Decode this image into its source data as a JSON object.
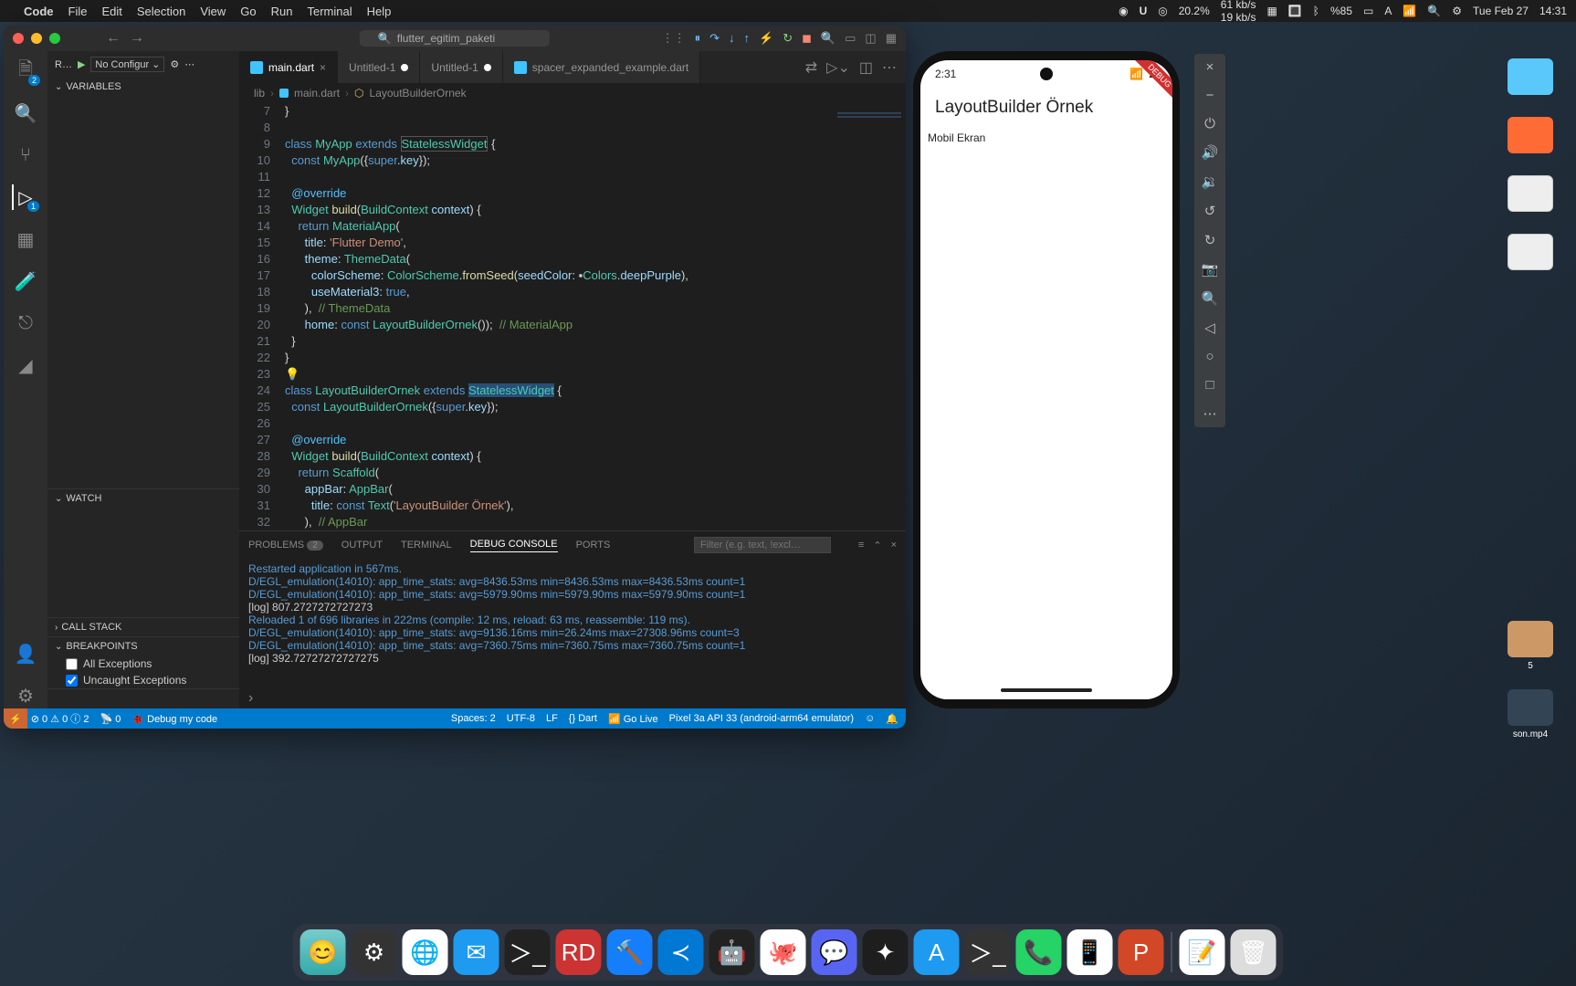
{
  "menubar": {
    "app": "Code",
    "items": [
      "File",
      "Edit",
      "Selection",
      "View",
      "Go",
      "Run",
      "Terminal",
      "Help"
    ],
    "right": {
      "cpu": "20.2%",
      "net_up": "61 kb/s",
      "net_down": "19 kb/s",
      "battery": "%85",
      "date": "Tue Feb 27",
      "time": "14:31"
    }
  },
  "vscode": {
    "title_search": "flutter_egitim_paketi",
    "tabs": [
      {
        "label": "main.dart",
        "active": true,
        "dirty": false
      },
      {
        "label": "Untitled-1",
        "active": false,
        "dirty": true
      },
      {
        "label": "Untitled-1",
        "active": false,
        "dirty": true
      },
      {
        "label": "spacer_expanded_example.dart",
        "active": false,
        "dirty": false
      }
    ],
    "breadcrumb": [
      "lib",
      "main.dart",
      "LayoutBuilderOrnek"
    ],
    "run_config_prefix": "R…",
    "run_config": "No Configur",
    "sidebar": {
      "variables": "VARIABLES",
      "watch": "WATCH",
      "call_stack": "CALL STACK",
      "breakpoints": "BREAKPOINTS",
      "bp_all": "All Exceptions",
      "bp_uncaught": "Uncaught Exceptions"
    },
    "code_lines": [
      {
        "n": 7,
        "html": "<span class='punc'>}</span>"
      },
      {
        "n": 8,
        "html": ""
      },
      {
        "n": 9,
        "html": "<span class='kw'>class</span> <span class='cls'>MyApp</span> <span class='kw'>extends</span> <span class='cls hlbox'>StatelessWidget</span> <span class='punc'>{</span>"
      },
      {
        "n": 10,
        "html": "  <span class='kw'>const</span> <span class='cls'>MyApp</span><span class='punc'>({</span><span class='kw'>super</span>.<span class='var'>key</span><span class='punc'>});</span>"
      },
      {
        "n": 11,
        "html": ""
      },
      {
        "n": 12,
        "html": "  <span class='at'>@override</span>"
      },
      {
        "n": 13,
        "html": "  <span class='cls'>Widget</span> <span class='fn'>build</span><span class='punc'>(</span><span class='cls'>BuildContext</span> <span class='var'>context</span><span class='punc'>) {</span>"
      },
      {
        "n": 14,
        "html": "    <span class='kw'>return</span> <span class='cls'>MaterialApp</span><span class='punc'>(</span>"
      },
      {
        "n": 15,
        "html": "      <span class='var'>title</span>: <span class='str'>'Flutter Demo'</span>,"
      },
      {
        "n": 16,
        "html": "      <span class='var'>theme</span>: <span class='cls'>ThemeData</span><span class='punc'>(</span>"
      },
      {
        "n": 17,
        "html": "        <span class='var'>colorScheme</span>: <span class='cls'>ColorScheme</span>.<span class='fn'>fromSeed</span><span class='punc'>(</span><span class='var'>seedColor</span>: ▪<span class='cls'>Colors</span>.<span class='var'>deepPurple</span><span class='punc'>),</span>"
      },
      {
        "n": 18,
        "html": "        <span class='var'>useMaterial3</span>: <span class='const'>true</span>,"
      },
      {
        "n": 19,
        "html": "      <span class='punc'>),</span>  <span class='cmt'>// ThemeData</span>"
      },
      {
        "n": 20,
        "html": "      <span class='var'>home</span>: <span class='kw'>const</span> <span class='cls'>LayoutBuilderOrnek</span><span class='punc'>());</span>  <span class='cmt'>// MaterialApp</span>"
      },
      {
        "n": 21,
        "html": "  <span class='punc'>}</span>"
      },
      {
        "n": 22,
        "html": "<span class='punc'>}</span>"
      },
      {
        "n": 23,
        "html": "<span style='color:#ffcc00'>💡</span>"
      },
      {
        "n": 24,
        "html": "<span class='kw'>class</span> <span class='cls'>LayoutBuilderOrnek</span> <span class='kw'>extends</span> <span class='cls hl'>StatelessWidget</span> <span class='punc'>{</span>"
      },
      {
        "n": 25,
        "html": "  <span class='kw'>const</span> <span class='cls'>LayoutBuilderOrnek</span><span class='punc'>({</span><span class='kw'>super</span>.<span class='var'>key</span><span class='punc'>});</span>"
      },
      {
        "n": 26,
        "html": ""
      },
      {
        "n": 27,
        "html": "  <span class='at'>@override</span>"
      },
      {
        "n": 28,
        "html": "  <span class='cls'>Widget</span> <span class='fn'>build</span><span class='punc'>(</span><span class='cls'>BuildContext</span> <span class='var'>context</span><span class='punc'>) {</span>"
      },
      {
        "n": 29,
        "html": "    <span class='kw'>return</span> <span class='cls'>Scaffold</span><span class='punc'>(</span>"
      },
      {
        "n": 30,
        "html": "      <span class='var'>appBar</span>: <span class='cls'>AppBar</span><span class='punc'>(</span>"
      },
      {
        "n": 31,
        "html": "        <span class='var'>title</span>: <span class='kw'>const</span> <span class='cls'>Text</span><span class='punc'>(</span><span class='str'>'LayoutBuilder Örnek'</span><span class='punc'>),</span>"
      },
      {
        "n": 32,
        "html": "      <span class='punc'>),</span>  <span class='cmt'>// AppBar</span>"
      }
    ],
    "panel": {
      "tabs": {
        "problems": "PROBLEMS",
        "problems_count": "2",
        "output": "OUTPUT",
        "terminal": "TERMINAL",
        "debug": "DEBUG CONSOLE",
        "ports": "PORTS"
      },
      "filter_placeholder": "Filter (e.g. text, !excl…",
      "lines": [
        "Restarted application in 567ms.",
        "D/EGL_emulation(14010): app_time_stats: avg=8436.53ms min=8436.53ms max=8436.53ms count=1",
        "D/EGL_emulation(14010): app_time_stats: avg=5979.90ms min=5979.90ms max=5979.90ms count=1",
        "[log] 807.2727272727273",
        "Reloaded 1 of 696 libraries in 222ms (compile: 12 ms, reload: 63 ms, reassemble: 119 ms).",
        "D/EGL_emulation(14010): app_time_stats: avg=9136.16ms min=26.24ms max=27308.96ms count=3",
        "D/EGL_emulation(14010): app_time_stats: avg=7360.75ms min=7360.75ms max=7360.75ms count=1",
        "[log] 392.72727272727275"
      ]
    },
    "statusbar": {
      "errors": "0",
      "warnings": "0",
      "info": "2",
      "radio": "0",
      "debug": "Debug my code",
      "spaces": "Spaces: 2",
      "encoding": "UTF-8",
      "eol": "LF",
      "lang": "Dart",
      "golive": "Go Live",
      "device": "Pixel 3a API 33 (android-arm64 emulator)"
    }
  },
  "emulator": {
    "time": "2:31",
    "appbar_title": "LayoutBuilder Örnek",
    "body_text": "Mobil Ekran",
    "debug_banner": "DEBUG"
  },
  "desktop_labels": {
    "num5": "5",
    "son": "son.mp4"
  }
}
